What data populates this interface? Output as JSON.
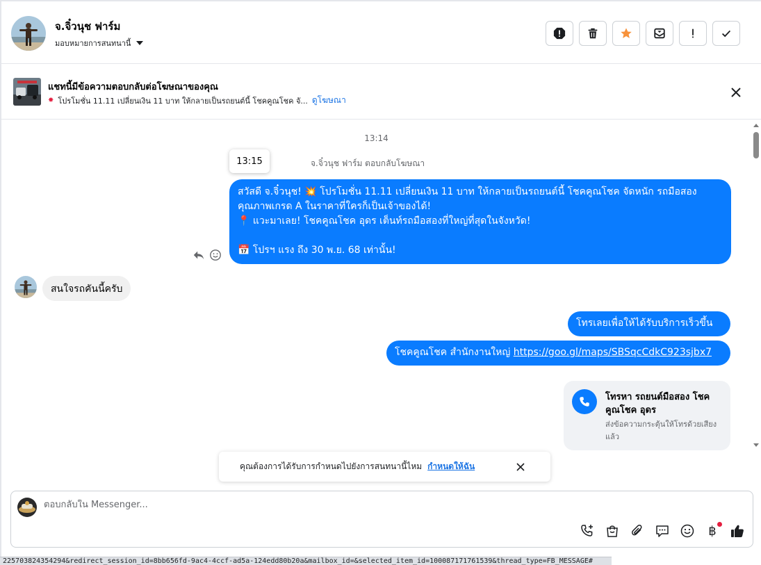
{
  "header": {
    "contact_name": "จ.จิ๋วนุช ฟาร์ม",
    "assign_label": "มอบหมายการสนทนานี้",
    "actions": [
      "mark-spam",
      "delete",
      "star",
      "move-to-inbox",
      "important",
      "done"
    ]
  },
  "ad_banner": {
    "title": "แชทนี้มีข้อความตอบกลับต่อโฆษณาของคุณ",
    "subtitle": "โปรโมชั่น 11.11 เปลี่ยนเงิน 11 บาท ให้กลายเป็นรถยนต์นี้ โชคคูณโชค จั...",
    "link": "ดูโฆษณา"
  },
  "conversation": {
    "timestamp": "13:14",
    "hover_time": "13:15",
    "reply_note": "จ.จิ๋วนุช ฟาร์ม ตอบกลับโฆษณา",
    "ad_message": {
      "line1": "สวัสดี จ.จิ๋วนุช! 💥 โปรโมชั่น 11.11 เปลี่ยนเงิน 11 บาท ให้กลายเป็นรถยนต์นี้ โชคคูณโชค จัดหนัก รถมือสอง",
      "line2": "คุณภาพเกรด A ในราคาที่ใครก็เป็นเจ้าของได้!",
      "line3": "📍 แวะมาเลย! โชคคูณโชค อุดร เต็นท์รถมือสองที่ใหญ่ที่สุดในจังหวัด!",
      "line4": "📅 โปรฯ แรง ถึง 30 พ.ย. 68 เท่านั้น!"
    },
    "incoming_message": "สนใจรถคันนี้ครับ",
    "outgoing_call_prompt": "โทรเลยเพื่อให้ได้รับบริการเร็วขึ้น",
    "outgoing_office_text": "โชคคูณโชค สำนักงานใหญ่",
    "outgoing_office_url": "https://goo.gl/maps/SBSqcCdkC923sjbx7",
    "call_card": {
      "title": "โทรหา รถยนต์มือสอง โชคคูณโชค อุดร",
      "subtitle": "ส่งข้อความกระตุ้นให้โทรด้วยเสียงแล้ว"
    }
  },
  "follow_toast": {
    "text": "คุณต้องการได้รับการกำหนดไปยังการสนทนานี้ไหม",
    "link": "กำหนดให้ฉัน"
  },
  "composer": {
    "placeholder": "ตอบกลับใน Messenger...",
    "baht_symbol": "฿"
  },
  "status_bar": {
    "url": "225703824354294&redirect_session_id=8bb656fd-9ac4-4ccf-ad5a-124edd80b20a&mailbox_id=&selected_item_id=100087171761539&thread_type=FB_MESSAGE#"
  },
  "colors": {
    "bubble_out": "#0a7cff",
    "bubble_in": "#f0f0f0",
    "link": "#1b74e4",
    "star": "#f7923b",
    "badge": "#e41e3f"
  }
}
